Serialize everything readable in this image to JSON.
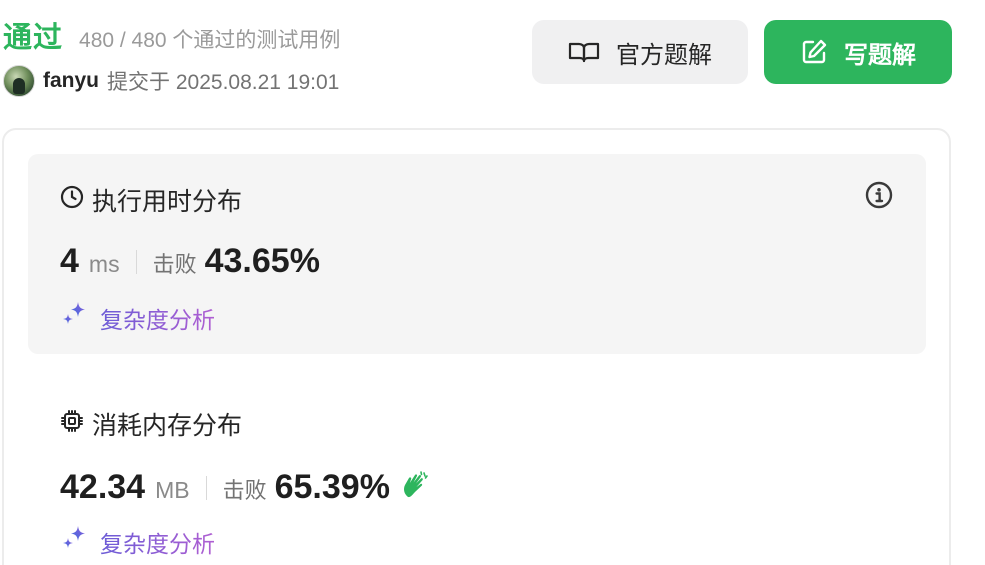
{
  "header": {
    "status": "通过",
    "cases_passed": "480 / 480 个通过的测试用例",
    "username": "fanyu",
    "submit_info": "提交于 2025.08.21 19:01"
  },
  "buttons": {
    "official_solution": "官方题解",
    "write_solution": "写题解"
  },
  "runtime": {
    "title": "执行用时分布",
    "value": "4",
    "unit": "ms",
    "beats_label": "击败",
    "beats_value": "43.65%",
    "analysis_link": "复杂度分析"
  },
  "memory": {
    "title": "消耗内存分布",
    "value": "42.34",
    "unit": "MB",
    "beats_label": "击败",
    "beats_value": "65.39%",
    "analysis_link": "复杂度分析"
  },
  "colors": {
    "accent_green": "#2db55d",
    "panel_bg": "#f5f5f5",
    "analysis_gradient_start": "#6b5bd6",
    "analysis_gradient_end": "#b05fd2"
  },
  "icons": {
    "official_solution": "book-icon",
    "write_solution": "edit-icon",
    "runtime": "clock-icon",
    "memory": "chip-icon",
    "info": "info-icon",
    "analysis": "sparkle-icon",
    "memory_badge": "clap-icon"
  }
}
